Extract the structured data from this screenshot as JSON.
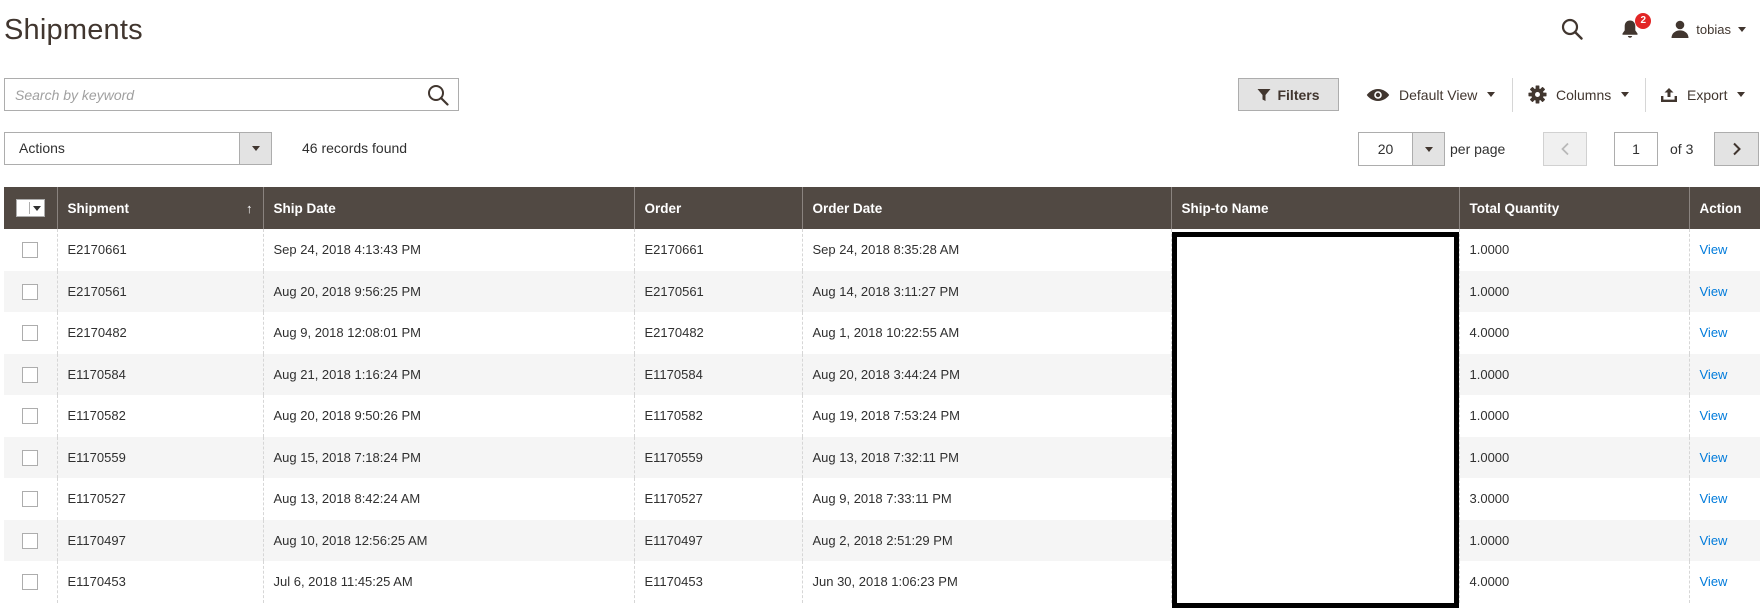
{
  "page": {
    "title": "Shipments"
  },
  "header": {
    "notification_count": "2",
    "username": "tobias"
  },
  "search": {
    "placeholder": "Search by keyword"
  },
  "toolbar": {
    "filters_label": "Filters",
    "view_label": "Default View",
    "columns_label": "Columns",
    "export_label": "Export"
  },
  "actions": {
    "label": "Actions"
  },
  "records_found": "46 records found",
  "pagination": {
    "per_page_value": "20",
    "per_page_label": "per page",
    "current_page": "1",
    "of_label": "of 3"
  },
  "table": {
    "columns": [
      "Shipment",
      "Ship Date",
      "Order",
      "Order Date",
      "Ship-to Name",
      "Total Quantity",
      "Action"
    ],
    "sort_indicator": "↑",
    "rows": [
      {
        "shipment": "E2170661",
        "ship_date": "Sep 24, 2018 4:13:43 PM",
        "order": "E2170661",
        "order_date": "Sep 24, 2018 8:35:28 AM",
        "ship_to": "",
        "qty": "1.0000",
        "action": "View"
      },
      {
        "shipment": "E2170561",
        "ship_date": "Aug 20, 2018 9:56:25 PM",
        "order": "E2170561",
        "order_date": "Aug 14, 2018 3:11:27 PM",
        "ship_to": "",
        "qty": "1.0000",
        "action": "View"
      },
      {
        "shipment": "E2170482",
        "ship_date": "Aug 9, 2018 12:08:01 PM",
        "order": "E2170482",
        "order_date": "Aug 1, 2018 10:22:55 AM",
        "ship_to": "",
        "qty": "4.0000",
        "action": "View"
      },
      {
        "shipment": "E1170584",
        "ship_date": "Aug 21, 2018 1:16:24 PM",
        "order": "E1170584",
        "order_date": "Aug 20, 2018 3:44:24 PM",
        "ship_to": "",
        "qty": "1.0000",
        "action": "View"
      },
      {
        "shipment": "E1170582",
        "ship_date": "Aug 20, 2018 9:50:26 PM",
        "order": "E1170582",
        "order_date": "Aug 19, 2018 7:53:24 PM",
        "ship_to": "",
        "qty": "1.0000",
        "action": "View"
      },
      {
        "shipment": "E1170559",
        "ship_date": "Aug 15, 2018 7:18:24 PM",
        "order": "E1170559",
        "order_date": "Aug 13, 2018 7:32:11 PM",
        "ship_to": "",
        "qty": "1.0000",
        "action": "View"
      },
      {
        "shipment": "E1170527",
        "ship_date": "Aug 13, 2018 8:42:24 AM",
        "order": "E1170527",
        "order_date": "Aug 9, 2018 7:33:11 PM",
        "ship_to": "",
        "qty": "3.0000",
        "action": "View"
      },
      {
        "shipment": "E1170497",
        "ship_date": "Aug 10, 2018 12:56:25 AM",
        "order": "E1170497",
        "order_date": "Aug 2, 2018 2:51:29 PM",
        "ship_to": "",
        "qty": "1.0000",
        "action": "View"
      },
      {
        "shipment": "E1170453",
        "ship_date": "Jul 6, 2018 11:45:25 AM",
        "order": "E1170453",
        "order_date": "Jun 30, 2018 1:06:23 PM",
        "ship_to": "",
        "qty": "4.0000",
        "action": "View"
      }
    ]
  }
}
